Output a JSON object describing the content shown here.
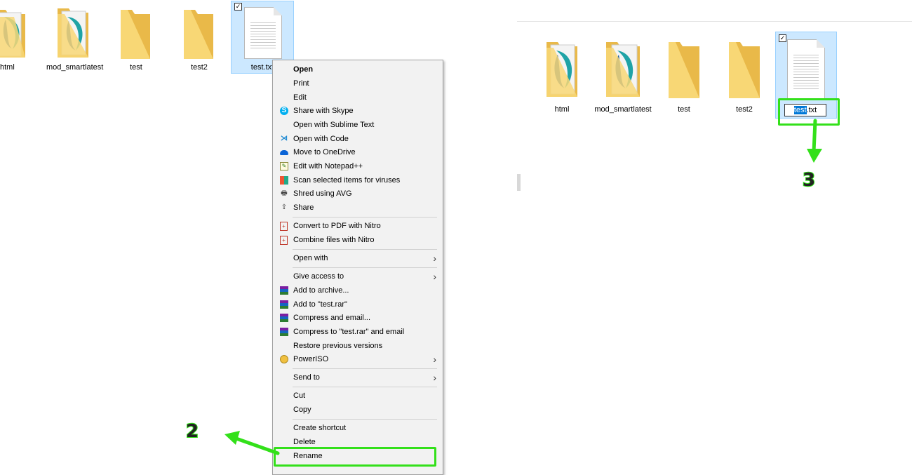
{
  "left_panel": {
    "items": [
      {
        "label": "html",
        "type": "folder-html"
      },
      {
        "label": "mod_smartlatest",
        "type": "folder-doc"
      },
      {
        "label": "test",
        "type": "folder"
      },
      {
        "label": "test2",
        "type": "folder"
      },
      {
        "label": "test.txt",
        "type": "text-file",
        "selected": true
      }
    ]
  },
  "context_menu": {
    "items": [
      {
        "label": "Open",
        "bold": true
      },
      {
        "label": "Print"
      },
      {
        "label": "Edit"
      },
      {
        "label": "Share with Skype",
        "icon": "skype-icon"
      },
      {
        "label": "Open with Sublime Text"
      },
      {
        "label": "Open with Code",
        "icon": "vscode-icon"
      },
      {
        "label": "Move to OneDrive",
        "icon": "onedrive-icon"
      },
      {
        "label": "Edit with Notepad++",
        "icon": "notepadpp-icon"
      },
      {
        "label": "Scan selected items for viruses",
        "icon": "avg-scan-icon"
      },
      {
        "label": "Shred using AVG",
        "icon": "shred-icon"
      },
      {
        "label": "Share",
        "icon": "share-icon"
      },
      {
        "label": "Convert to PDF with Nitro",
        "icon": "nitro-pdf-icon"
      },
      {
        "label": "Combine files with Nitro",
        "icon": "nitro-combine-icon"
      },
      {
        "label": "Open with",
        "submenu": true
      },
      {
        "label": "Give access to",
        "submenu": true
      },
      {
        "label": "Add to archive...",
        "icon": "winrar-icon"
      },
      {
        "label": "Add to \"test.rar\"",
        "icon": "winrar-icon"
      },
      {
        "label": "Compress and email...",
        "icon": "winrar-icon"
      },
      {
        "label": "Compress to \"test.rar\" and email",
        "icon": "winrar-icon"
      },
      {
        "label": "Restore previous versions"
      },
      {
        "label": "PowerISO",
        "icon": "poweriso-icon",
        "submenu": true
      },
      {
        "label": "Send to",
        "submenu": true
      },
      {
        "label": "Cut"
      },
      {
        "label": "Copy"
      },
      {
        "label": "Create shortcut"
      },
      {
        "label": "Delete"
      },
      {
        "label": "Rename"
      }
    ]
  },
  "right_panel": {
    "items": [
      {
        "label": "html"
      },
      {
        "label": "mod_smartlatest"
      },
      {
        "label": "test"
      },
      {
        "label": "test2"
      }
    ],
    "rename_input": {
      "selected_part": "test",
      "rest": ".txt"
    }
  },
  "annotations": {
    "step2": "2",
    "step3": "3",
    "highlight_color": "#33e01a"
  },
  "colors": {
    "folder": "#f8d775",
    "folder_dark": "#e9b949",
    "selection": "#cce8ff",
    "selection_border": "#99d1ff"
  }
}
